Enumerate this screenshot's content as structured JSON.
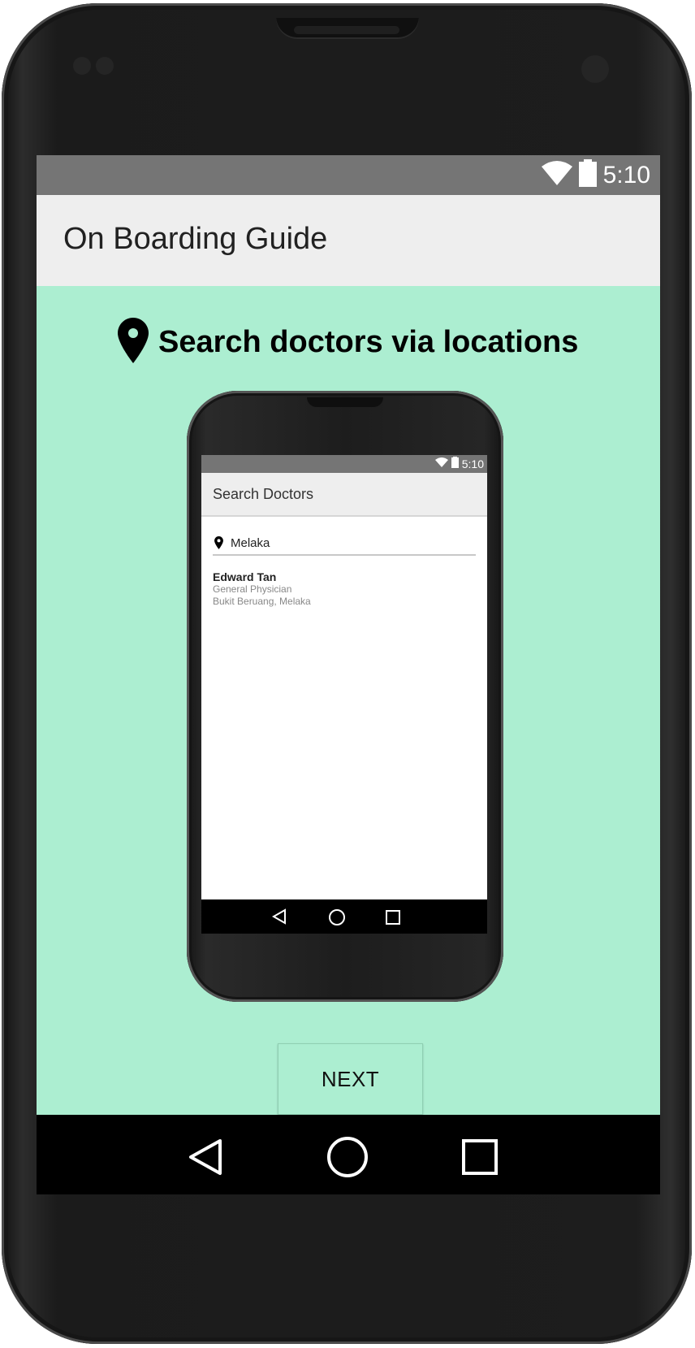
{
  "status_bar": {
    "time": "5:10"
  },
  "app_bar": {
    "title": "On Boarding Guide"
  },
  "headline": {
    "text": "Search doctors via locations"
  },
  "preview": {
    "status_time": "5:10",
    "title": "Search Doctors",
    "search_value": "Melaka",
    "result": {
      "name": "Edward Tan",
      "specialty": "General Physician",
      "location": "Bukit Beruang, Melaka"
    }
  },
  "next_button": {
    "label": "NEXT"
  },
  "colors": {
    "background": "#aceed1",
    "status_bar": "#757575",
    "app_bar": "#eeeeee"
  },
  "icons": {
    "wifi": "wifi-icon",
    "battery": "battery-icon",
    "location": "location-pin-icon",
    "back": "back-icon",
    "home": "home-icon",
    "recents": "recents-icon"
  }
}
